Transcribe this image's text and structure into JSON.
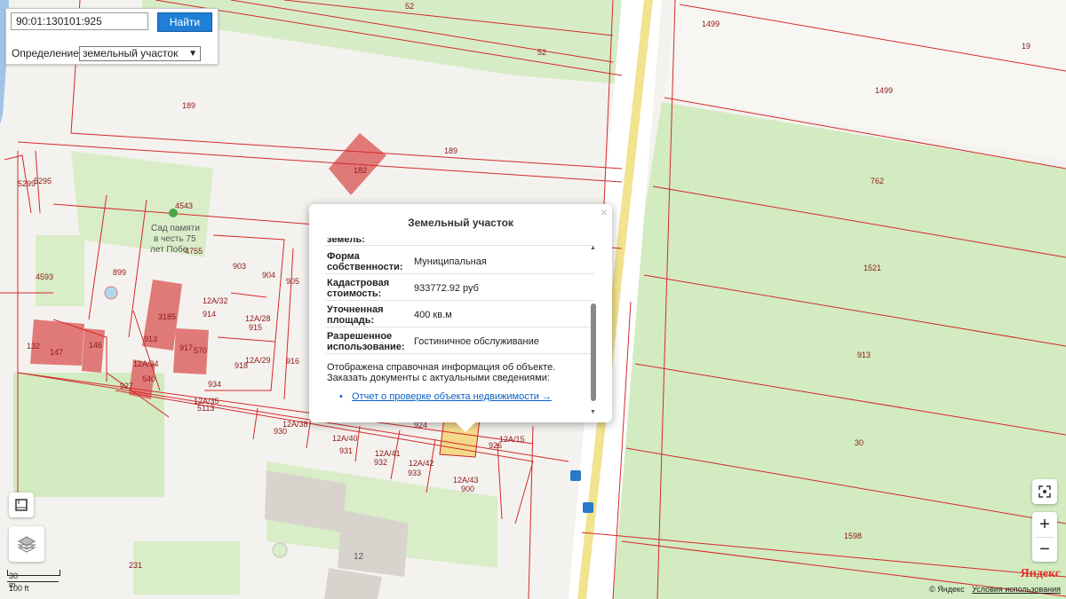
{
  "search": {
    "query": "90:01:130101:925",
    "button_label": "Найти",
    "definition_label": "Определение:",
    "definition_selected": "земельный участок"
  },
  "popup": {
    "title": "Земельный участок",
    "cut_top_text": "земель:",
    "rows": [
      {
        "key": "Форма собственности:",
        "value": "Муниципальная"
      },
      {
        "key": "Кадастровая стоимость:",
        "value": "933772.92 руб"
      },
      {
        "key": "Уточненная площадь:",
        "value": "400 кв.м"
      },
      {
        "key": "Разрешенное использование:",
        "value": "Гостиничное обслуживание"
      }
    ],
    "note": "Отображена справочная информация об объекте. Заказать документы с актуальными сведениями:",
    "link": "Отчет о проверке объекта недвижимости →",
    "close": "×"
  },
  "map": {
    "parcel_labels": [
      "52",
      "52",
      "189",
      "189",
      "1499",
      "19",
      "1499",
      "762",
      "1521",
      "913",
      "30",
      "1598",
      "182",
      "4543",
      "4755",
      "899",
      "4593",
      "5299",
      "5295",
      "903",
      "904",
      "905",
      "914",
      "915",
      "916",
      "918",
      "12А/32",
      "12А/28",
      "12А/29",
      "3185",
      "913",
      "917",
      "570",
      "132",
      "147",
      "146",
      "927",
      "540",
      "934",
      "12А/34",
      "12А/35",
      "5113",
      "930",
      "931",
      "932",
      "933",
      "900",
      "12А/38",
      "12А/40",
      "12А/41",
      "12А/42",
      "12А/43",
      "924",
      "926",
      "12А/15",
      "231",
      "12"
    ],
    "poi_labels": [
      "Сад памяти",
      "в честь 75",
      "лет Побе"
    ]
  },
  "scale": {
    "meters": "30 m",
    "feet": "100 ft"
  },
  "footer": {
    "copyright": "© Яндекс",
    "terms": "Условия использования",
    "logo": "Яндекс"
  },
  "controls": {
    "zoom_in": "+",
    "zoom_out": "−"
  }
}
